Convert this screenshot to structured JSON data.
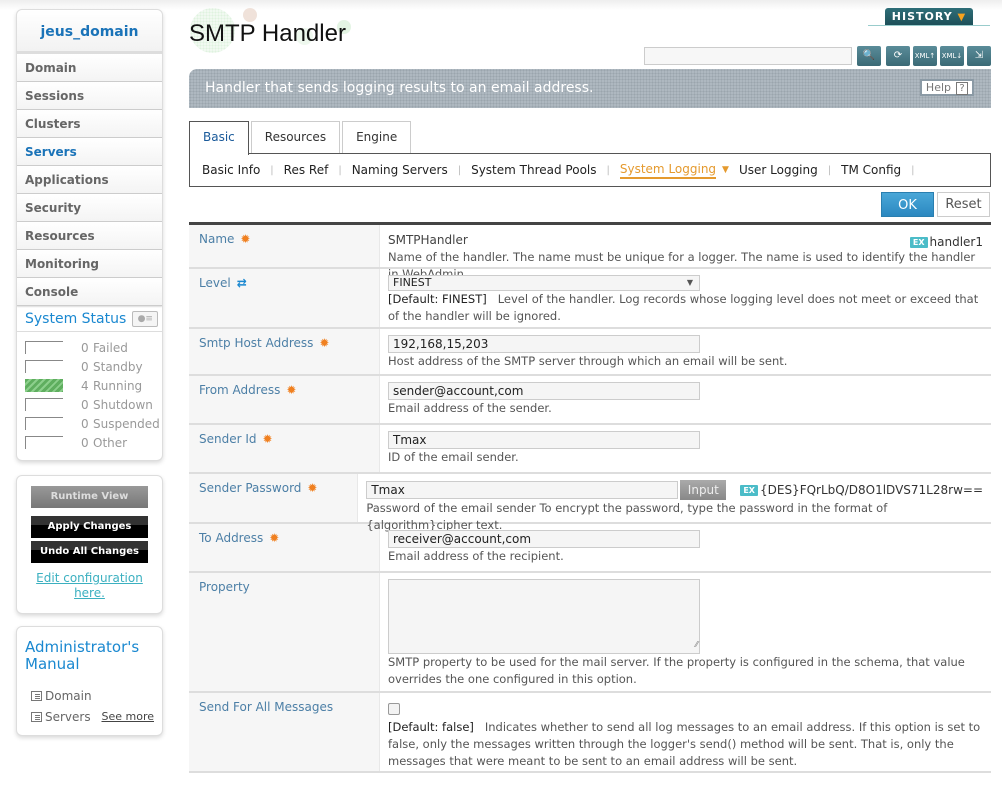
{
  "sidebar": {
    "domain": "jeus_domain",
    "nav": [
      "Domain",
      "Sessions",
      "Clusters",
      "Servers",
      "Applications",
      "Security",
      "Resources",
      "Monitoring",
      "Console"
    ],
    "active_nav": "Servers",
    "system_status": {
      "title": "System Status",
      "items": [
        {
          "count": "0",
          "label": "Failed"
        },
        {
          "count": "0",
          "label": "Standby"
        },
        {
          "count": "4",
          "label": "Running"
        },
        {
          "count": "0",
          "label": "Shutdown"
        },
        {
          "count": "0",
          "label": "Suspended"
        },
        {
          "count": "0",
          "label": "Other"
        }
      ]
    },
    "buttons": {
      "runtime_view": "Runtime View",
      "apply_changes": "Apply Changes",
      "undo_all": "Undo All Changes",
      "edit_link": "Edit configuration here."
    },
    "manual": {
      "title": "Administrator's Manual",
      "items": [
        "Domain",
        "Servers"
      ],
      "see_more": "See more"
    }
  },
  "header": {
    "title": "SMTP Handler",
    "history": "HISTORY",
    "search_placeholder": "",
    "toolbar_icons": [
      "search-icon",
      "refresh-icon",
      "xml-upload-icon",
      "xml-download-icon",
      "export-icon"
    ],
    "description": "Handler that sends logging results to an email address.",
    "help": "Help",
    "help_icon": "?"
  },
  "tabs": [
    "Basic",
    "Resources",
    "Engine"
  ],
  "active_tab": "Basic",
  "subnav": [
    "Basic Info",
    "Res Ref",
    "Naming Servers",
    "System Thread Pools",
    "System Logging",
    "User Logging",
    "TM Config"
  ],
  "active_subnav": "System Logging",
  "actions": {
    "ok": "OK",
    "reset": "Reset"
  },
  "colors": {
    "accent": "#1a88d0",
    "active_subnav": "#e59a2e",
    "required": "#f08020",
    "ok_button": "#2b88c0"
  },
  "form": {
    "name": {
      "label": "Name",
      "value": "SMTPHandler",
      "example": "handler1",
      "desc": "Name of the handler. The name must be unique for a logger. The name is used to identify the handler in WebAdmin."
    },
    "level": {
      "label": "Level",
      "value": "FINEST",
      "default": "[Default: FINEST]",
      "desc": "Level of the handler. Log records whose logging level does not meet or exceed that of the handler will be ignored."
    },
    "smtp_host": {
      "label": "Smtp Host Address",
      "value": "192,168,15,203",
      "desc": "Host address of the SMTP server through which an email will be sent."
    },
    "from_address": {
      "label": "From Address",
      "value": "sender@account,com",
      "desc": "Email address of the sender."
    },
    "sender_id": {
      "label": "Sender Id",
      "value": "Tmax",
      "desc": "ID of the email sender."
    },
    "sender_password": {
      "label": "Sender Password",
      "value": "Tmax",
      "input_button": "Input",
      "example": "{DES}FQrLbQ/D8O1lDVS71L28rw==",
      "desc": "Password of the email sender To encrypt the password, type the password in the format of {algorithm}cipher text."
    },
    "to_address": {
      "label": "To Address",
      "value": "receiver@account,com",
      "desc": "Email address of the recipient."
    },
    "property": {
      "label": "Property",
      "value": "",
      "desc": "SMTP property to be used for the mail server. If the property is configured in the schema, that value overrides the one configured in this option."
    },
    "send_all": {
      "label": "Send For All Messages",
      "checked": false,
      "default": "[Default: false]",
      "desc": "Indicates whether to send all log messages to an email address. If this option is set to false, only the messages written through the logger's send() method will be sent. That is, only the messages that were meant to be sent to an email address will be sent."
    }
  }
}
